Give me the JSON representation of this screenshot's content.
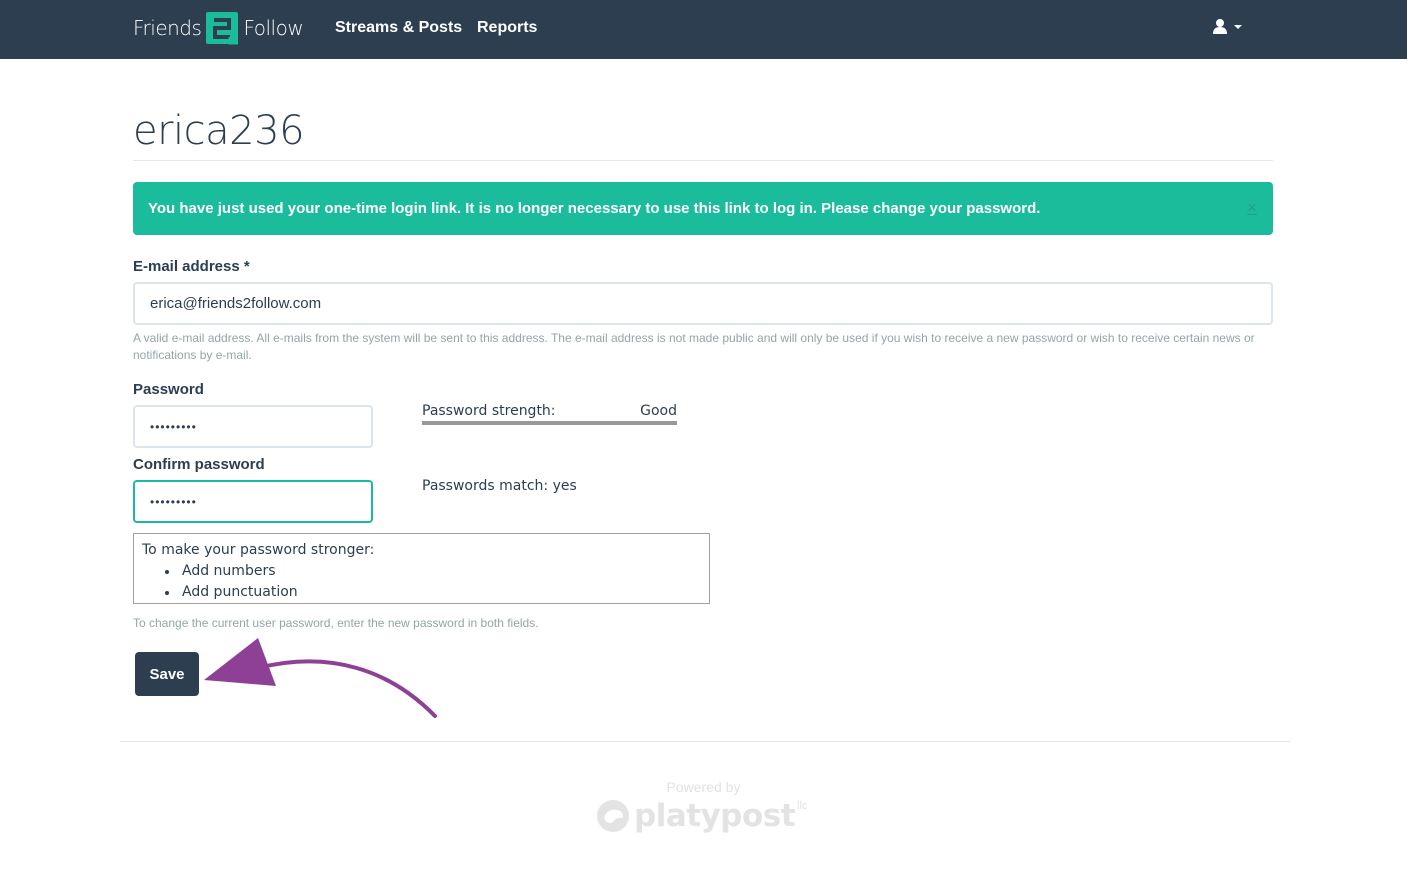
{
  "navbar": {
    "brand": {
      "left_word": "Friends",
      "mark": "2",
      "right_word": "Follow"
    },
    "links": [
      {
        "label": "Streams & Posts"
      },
      {
        "label": "Reports"
      }
    ],
    "user_icon": "user-icon"
  },
  "page": {
    "title": "erica236"
  },
  "alert": {
    "message": "You have just used your one-time login link. It is no longer necessary to use this link to log in. Please change your password.",
    "close": "×"
  },
  "form": {
    "email": {
      "label": "E-mail address *",
      "value": "erica@friends2follow.com",
      "help": "A valid e-mail address. All e-mails from the system will be sent to this address. The e-mail address is not made public and will only be used if you wish to receive a new password or wish to receive certain news or notifications by e-mail."
    },
    "password": {
      "label": "Password",
      "value": "•••••••••",
      "strength_label": "Password strength:",
      "strength_value": "Good",
      "strength_fraction": 1.0
    },
    "confirm": {
      "label": "Confirm password",
      "value": "•••••••••",
      "match_text": "Passwords match: yes"
    },
    "suggestions": {
      "heading": "To make your password stronger:",
      "items": [
        "Add numbers",
        "Add punctuation"
      ]
    },
    "password_help": "To change the current user password, enter the new password in both fields.",
    "save_label": "Save"
  },
  "footer": {
    "powered_by": "Powered by",
    "brand": "platypost",
    "brand_suffix": "llc"
  },
  "colors": {
    "navbar": "#2c3e50",
    "accent": "#1abc9c",
    "annotation_arrow": "#8e3f96"
  }
}
